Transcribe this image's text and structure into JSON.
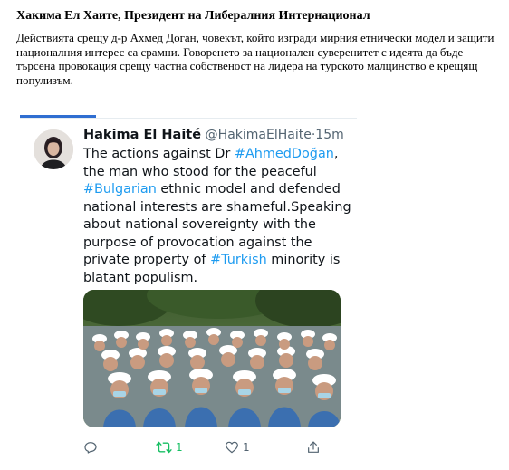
{
  "article": {
    "title": "Хакима Ел Хаите, Президент на Либералния Интернационал",
    "body": "Действията срещу д-р Ахмед Доган, човекът, който изгради мирния етнически модел и защити националния интерес са срамни. Говоренето за национален суверенитет с идеята да бъде търсена провокация срещу частна собственост на лидера на турското малцинство е крещящ популизъм."
  },
  "tweet": {
    "author_name": "Hakima El Haité",
    "handle": "@HakimaElHaite",
    "separator": "·",
    "time": "15m",
    "text_parts": {
      "p1": "The actions against Dr ",
      "h1": "#AhmedDoğan",
      "p2": ", the man who stood for the peaceful ",
      "h2": "#Bulgarian",
      "p3": " ethnic model and defended national interests are shameful.Speaking about national sovereignty with the purpose of provocation against the private property  of ",
      "h3": "#Turkish",
      "p4": " minority is blatant populism."
    },
    "photo_icon": "crowd-photo",
    "actions": {
      "reply_icon": "reply-icon",
      "retweet_icon": "retweet-icon",
      "retweet_count": "1",
      "like_icon": "heart-icon",
      "like_count": "1",
      "share_icon": "share-icon"
    },
    "colors": {
      "hashtag": "#1d9bf0",
      "retweet": "#17bf63",
      "meta": "#536471"
    }
  }
}
